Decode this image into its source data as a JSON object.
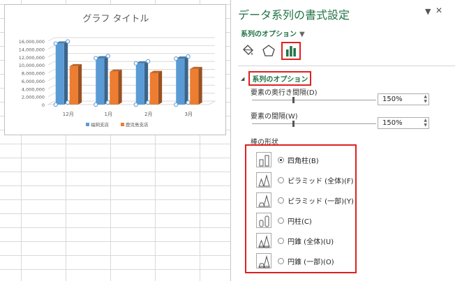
{
  "pane": {
    "title": "データ系列の書式設定",
    "series_dropdown": "系列のオプション",
    "section_title": "系列のオプション",
    "gap_depth_label": "要素の奥行き間隔(D)",
    "gap_depth_value": "150%",
    "gap_width_label": "要素の間隔(W)",
    "gap_width_value": "150%",
    "shape_label": "棒の形状",
    "shapes": [
      {
        "label": "四角柱(B)",
        "selected": true
      },
      {
        "label": "ピラミッド (全体)(F)",
        "selected": false
      },
      {
        "label": "ピラミッド (一部)(Y)",
        "selected": false
      },
      {
        "label": "円柱(C)",
        "selected": false
      },
      {
        "label": "円錐 (全体)(U)",
        "selected": false
      },
      {
        "label": "円錐 (一部)(O)",
        "selected": false
      }
    ],
    "tab_icons": [
      "fill-bucket-icon",
      "pentagon-effects-icon",
      "bar-chart-options-icon"
    ]
  },
  "chart_data": {
    "type": "bar",
    "title": "グラフ タイトル",
    "categories": [
      "12月",
      "1月",
      "2月",
      "3月"
    ],
    "series": [
      {
        "name": "福岡支店",
        "values": [
          15400000,
          11700000,
          10400000,
          11600000
        ],
        "color": "#5b9bd5"
      },
      {
        "name": "鹿児島支店",
        "values": [
          9700000,
          8300000,
          8000000,
          9000000
        ],
        "color": "#ed7d31"
      }
    ],
    "yticks": [
      "0",
      "2,000,000",
      "4,000,000",
      "6,000,000",
      "8,000,000",
      "10,000,000",
      "12,000,000",
      "14,000,000",
      "16,000,000"
    ],
    "ylim": [
      0,
      16000000
    ],
    "legend": "bottom",
    "grid": true
  }
}
